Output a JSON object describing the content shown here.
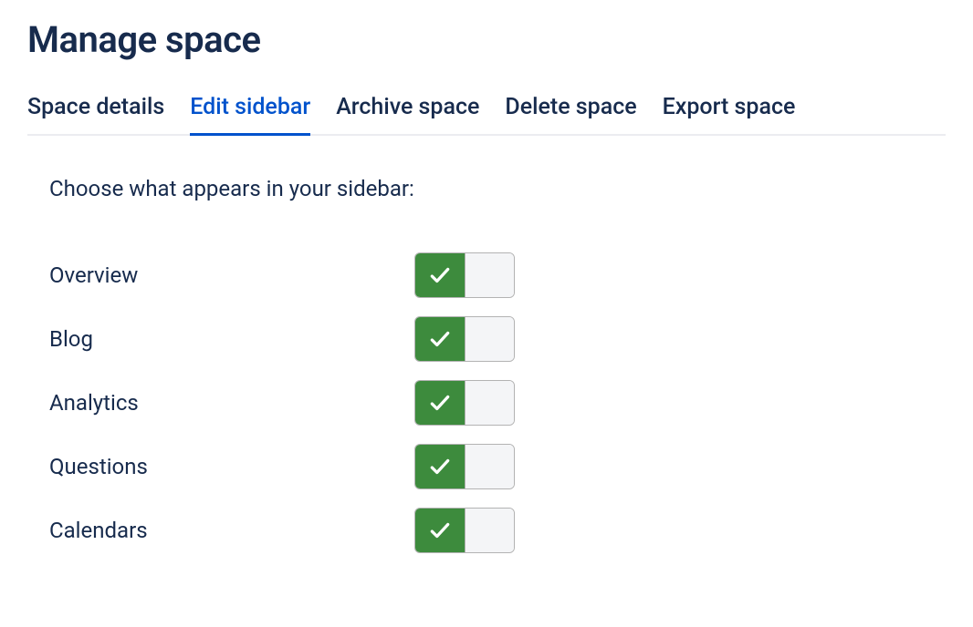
{
  "page": {
    "title": "Manage space"
  },
  "tabs": [
    {
      "label": "Space details",
      "active": false
    },
    {
      "label": "Edit sidebar",
      "active": true
    },
    {
      "label": "Archive space",
      "active": false
    },
    {
      "label": "Delete space",
      "active": false
    },
    {
      "label": "Export space",
      "active": false
    }
  ],
  "content": {
    "instruction": "Choose what appears in your sidebar:"
  },
  "options": [
    {
      "label": "Overview",
      "enabled": true
    },
    {
      "label": "Blog",
      "enabled": true
    },
    {
      "label": "Analytics",
      "enabled": true
    },
    {
      "label": "Questions",
      "enabled": true
    },
    {
      "label": "Calendars",
      "enabled": true
    }
  ]
}
